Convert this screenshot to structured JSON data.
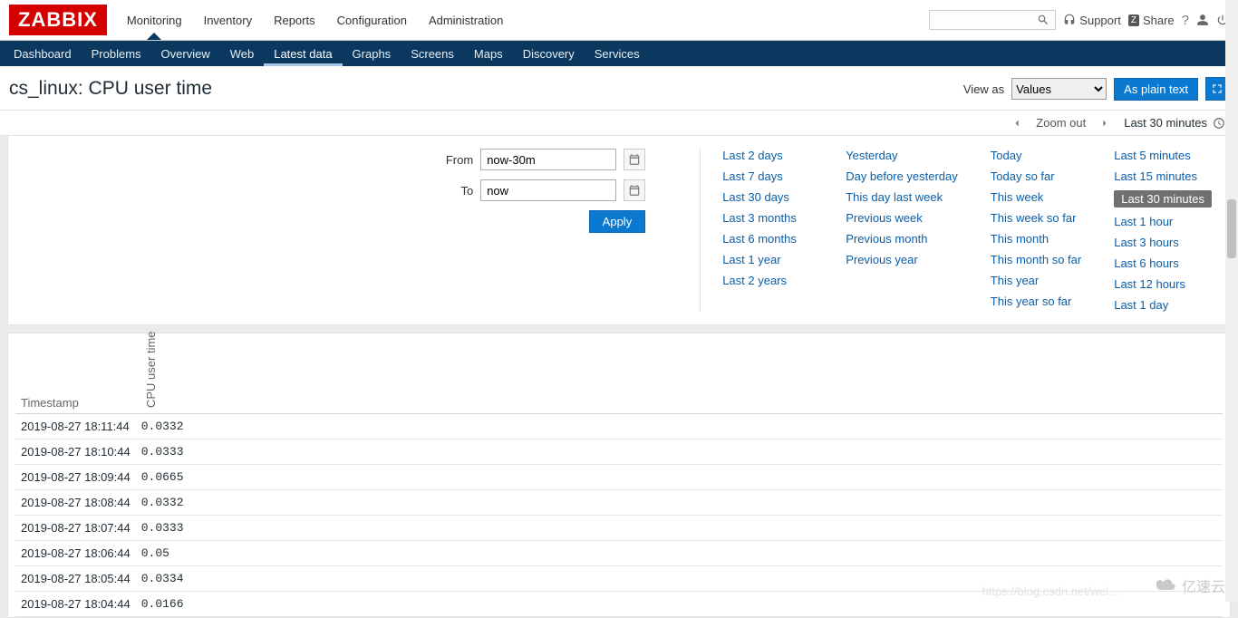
{
  "brand": "ZABBIX",
  "main_nav": [
    "Monitoring",
    "Inventory",
    "Reports",
    "Configuration",
    "Administration"
  ],
  "main_nav_active": "Monitoring",
  "header_links": {
    "support": "Support",
    "share": "Share"
  },
  "sub_nav": [
    "Dashboard",
    "Problems",
    "Overview",
    "Web",
    "Latest data",
    "Graphs",
    "Screens",
    "Maps",
    "Discovery",
    "Services"
  ],
  "sub_nav_active": "Latest data",
  "page_title": "cs_linux: CPU user time",
  "view_as_label": "View as",
  "view_as_value": "Values",
  "as_plain_text": "As plain text",
  "time_nav": {
    "zoom_out": "Zoom out",
    "range_label": "Last 30 minutes"
  },
  "filter": {
    "from_label": "From",
    "from_value": "now-30m",
    "to_label": "To",
    "to_value": "now",
    "apply": "Apply"
  },
  "presets": {
    "col1": [
      "Last 2 days",
      "Last 7 days",
      "Last 30 days",
      "Last 3 months",
      "Last 6 months",
      "Last 1 year",
      "Last 2 years"
    ],
    "col2": [
      "Yesterday",
      "Day before yesterday",
      "This day last week",
      "Previous week",
      "Previous month",
      "Previous year"
    ],
    "col3": [
      "Today",
      "Today so far",
      "This week",
      "This week so far",
      "This month",
      "This month so far",
      "This year",
      "This year so far"
    ],
    "col4": [
      "Last 5 minutes",
      "Last 15 minutes",
      "Last 30 minutes",
      "Last 1 hour",
      "Last 3 hours",
      "Last 6 hours",
      "Last 12 hours",
      "Last 1 day"
    ],
    "selected": "Last 30 minutes"
  },
  "table": {
    "col_timestamp": "Timestamp",
    "col_value": "CPU user time",
    "rows": [
      {
        "ts": "2019-08-27 18:11:44",
        "v": "0.0332"
      },
      {
        "ts": "2019-08-27 18:10:44",
        "v": "0.0333"
      },
      {
        "ts": "2019-08-27 18:09:44",
        "v": "0.0665"
      },
      {
        "ts": "2019-08-27 18:08:44",
        "v": "0.0332"
      },
      {
        "ts": "2019-08-27 18:07:44",
        "v": "0.0333"
      },
      {
        "ts": "2019-08-27 18:06:44",
        "v": "0.05"
      },
      {
        "ts": "2019-08-27 18:05:44",
        "v": "0.0334"
      },
      {
        "ts": "2019-08-27 18:04:44",
        "v": "0.0166"
      }
    ]
  },
  "watermark": {
    "blog": "https://blog.csdn.net/wei…",
    "brand": "亿速云"
  }
}
